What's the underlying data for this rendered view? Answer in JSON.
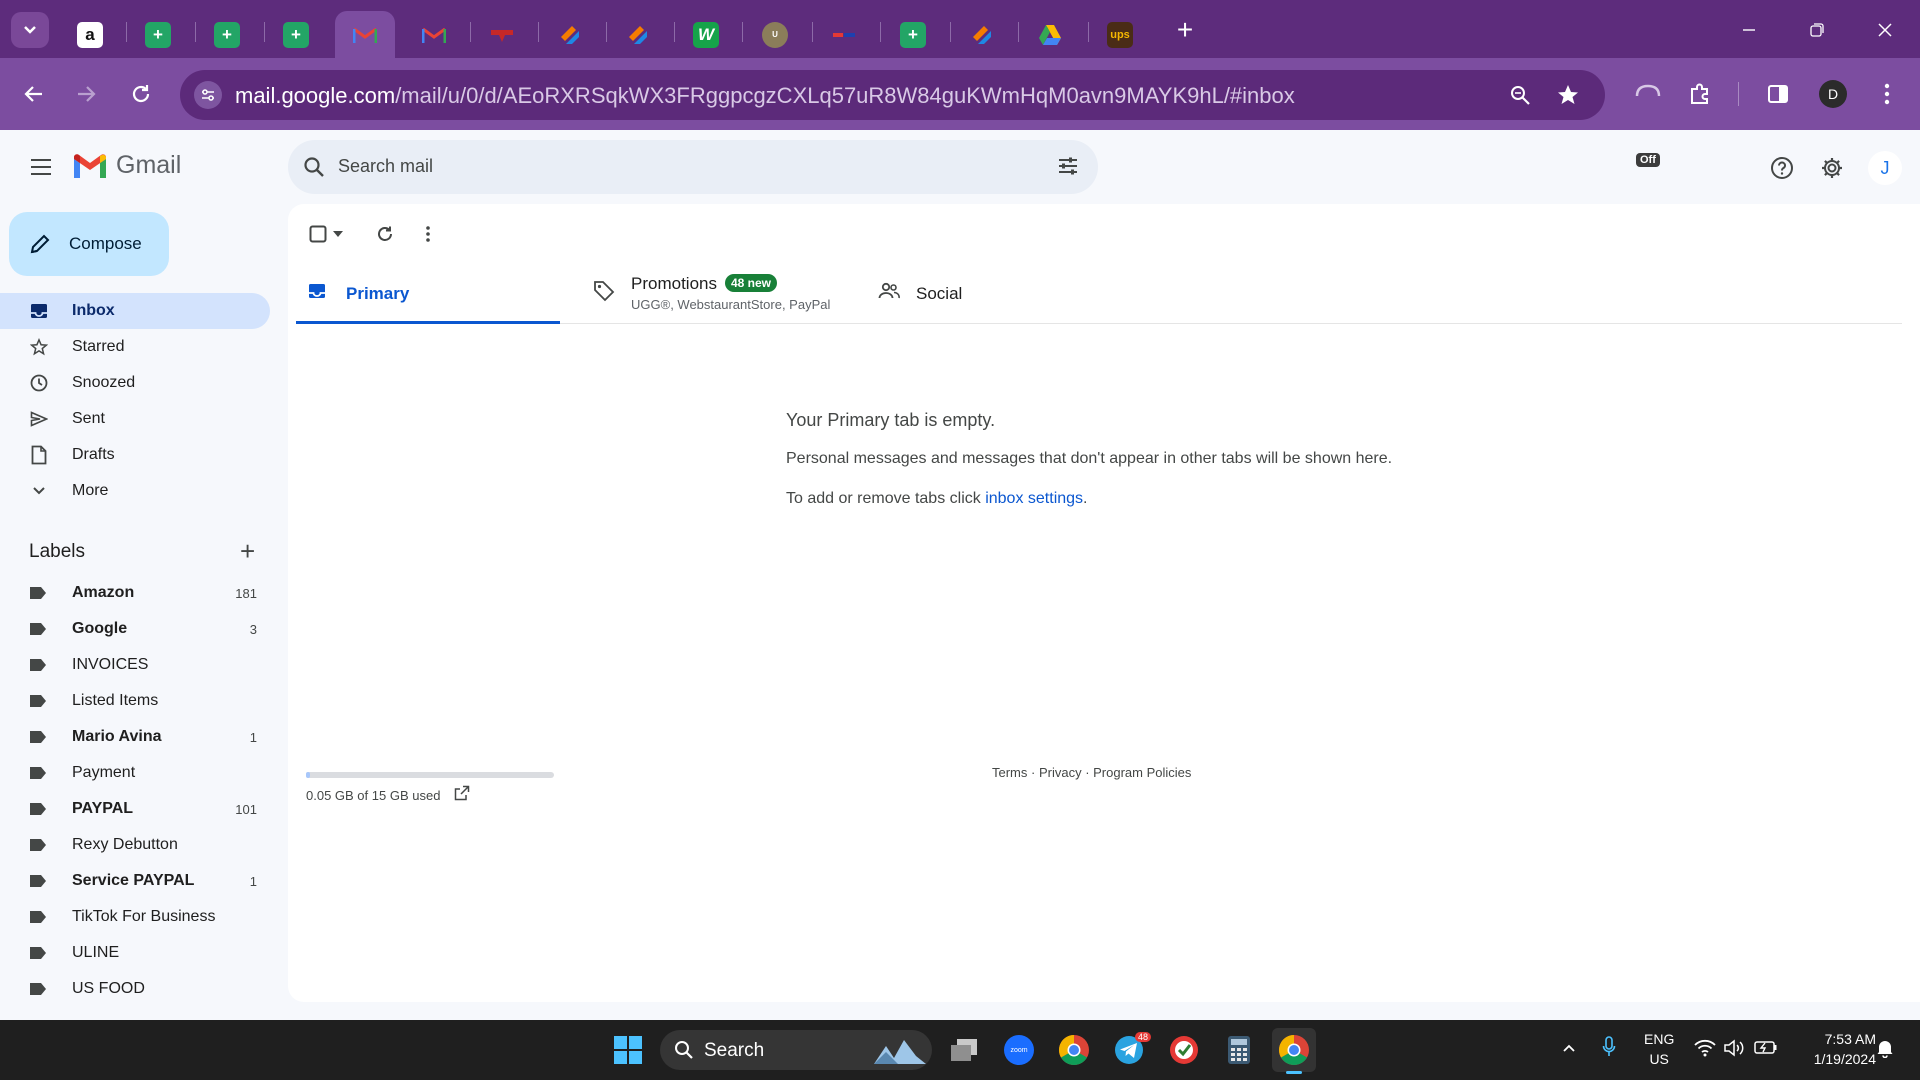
{
  "browser": {
    "url_host": "mail.google.com",
    "url_path": "/mail/u/0/d/AEoRXRSqkWX3FRggpcgzCXLq57uR8W84guKWmHqM0avn9MAYK9hL/#inbox",
    "profile_initial": "D",
    "extension_badge": "Off",
    "tabs": [
      {
        "icon": "amazon-icon"
      },
      {
        "icon": "sheets-icon"
      },
      {
        "icon": "sheets-icon"
      },
      {
        "icon": "sheets-icon"
      },
      {
        "icon": "gmail-icon",
        "active": true
      },
      {
        "icon": "gmail-icon"
      },
      {
        "icon": "red-site-icon"
      },
      {
        "icon": "orange-app-icon"
      },
      {
        "icon": "orange-app-icon"
      },
      {
        "icon": "green-w-icon"
      },
      {
        "icon": "uline-icon"
      },
      {
        "icon": "small-logo-icon"
      },
      {
        "icon": "sheets-icon"
      },
      {
        "icon": "orange-app-icon"
      },
      {
        "icon": "drive-icon"
      },
      {
        "icon": "ups-icon"
      }
    ]
  },
  "gmail": {
    "brand": "Gmail",
    "search_placeholder": "Search mail",
    "account_initial": "J",
    "compose_label": "Compose",
    "nav": [
      {
        "label": "Inbox",
        "icon": "inbox-icon",
        "active": true
      },
      {
        "label": "Starred",
        "icon": "star-icon"
      },
      {
        "label": "Snoozed",
        "icon": "clock-icon"
      },
      {
        "label": "Sent",
        "icon": "send-icon"
      },
      {
        "label": "Drafts",
        "icon": "draft-icon"
      },
      {
        "label": "More",
        "icon": "chevron-down-icon"
      }
    ],
    "labels_title": "Labels",
    "labels": [
      {
        "name": "Amazon",
        "count": "181",
        "bold": true
      },
      {
        "name": "Google",
        "count": "3",
        "bold": true
      },
      {
        "name": "INVOICES",
        "count": "",
        "bold": false
      },
      {
        "name": "Listed Items",
        "count": "",
        "bold": false
      },
      {
        "name": "Mario Avina",
        "count": "1",
        "bold": true
      },
      {
        "name": "Payment",
        "count": "",
        "bold": false
      },
      {
        "name": "PAYPAL",
        "count": "101",
        "bold": true
      },
      {
        "name": "Rexy Debutton",
        "count": "",
        "bold": false
      },
      {
        "name": "Service PAYPAL",
        "count": "1",
        "bold": true
      },
      {
        "name": "TikTok For Business",
        "count": "",
        "bold": false
      },
      {
        "name": "ULINE",
        "count": "",
        "bold": false
      },
      {
        "name": "US FOOD",
        "count": "",
        "bold": false
      }
    ],
    "tabs": {
      "primary": "Primary",
      "promotions": "Promotions",
      "promotions_badge": "48 new",
      "promotions_sub": "UGG®, WebstaurantStore, PayPal",
      "social": "Social"
    },
    "empty": {
      "title": "Your Primary tab is empty.",
      "line1": "Personal messages and messages that don't appear in other tabs will be shown here.",
      "line2_prefix": "To add or remove tabs click ",
      "line2_link": "inbox settings",
      "line2_suffix": "."
    },
    "storage": {
      "text": "0.05 GB of 15 GB used",
      "used_fraction": 0.0033
    },
    "footer": {
      "terms": "Terms",
      "privacy": "Privacy",
      "policies": "Program Policies",
      "sep": " · "
    }
  },
  "taskbar": {
    "search_label": "Search",
    "telegram_badge": "48",
    "lang_top": "ENG",
    "lang_bottom": "US",
    "time": "7:53 AM",
    "date": "1/19/2024"
  },
  "colors": {
    "chrome_tabstrip": "#5d2c7c",
    "chrome_toolbar": "#7c4da0",
    "gmail_accent": "#0b57d0",
    "compose_bg": "#c2e7ff",
    "inbox_active_bg": "#d3e3fd",
    "new_badge": "#188038"
  }
}
